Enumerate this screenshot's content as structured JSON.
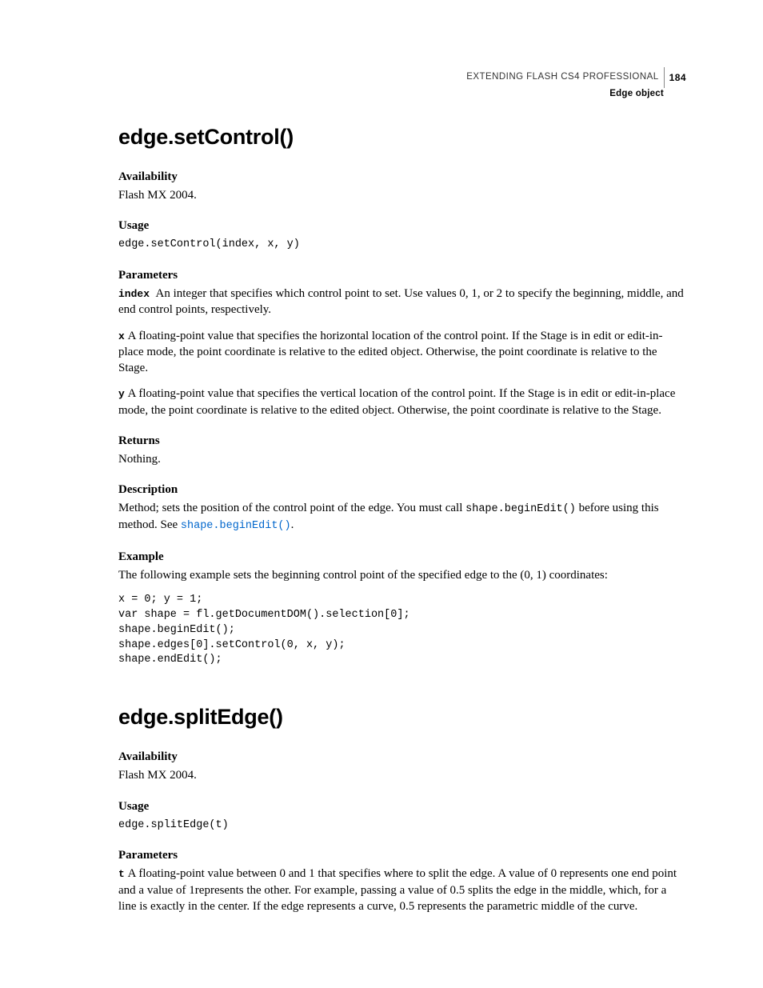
{
  "header": {
    "doc_title": "EXTENDING FLASH CS4 PROFESSIONAL",
    "page_number": "184",
    "section": "Edge object"
  },
  "method1": {
    "title": "edge.setControl()",
    "availability": {
      "label": "Availability",
      "text": "Flash MX 2004."
    },
    "usage": {
      "label": "Usage",
      "code": "edge.setControl(index, x, y)"
    },
    "parameters": {
      "label": "Parameters",
      "index": {
        "name": "index",
        "desc": "An integer that specifies which control point to set. Use values 0, 1, or 2 to specify the beginning, middle, and end control points, respectively."
      },
      "x": {
        "name": "x",
        "desc": "A floating-point value that specifies the horizontal location of the control point. If the Stage is in edit or edit-in-place mode, the point coordinate is relative to the edited object. Otherwise, the point coordinate is relative to the Stage."
      },
      "y": {
        "name": "y",
        "desc": "A floating-point value that specifies the vertical location of the control point. If the Stage is in edit or edit-in-place mode, the point coordinate is relative to the edited object. Otherwise, the point coordinate is relative to the Stage."
      }
    },
    "returns": {
      "label": "Returns",
      "text": "Nothing."
    },
    "description": {
      "label": "Description",
      "pre": "Method; sets the position of the control point of the edge. You must call ",
      "code1": "shape.beginEdit()",
      "mid": " before using this method. See ",
      "link": "shape.beginEdit()",
      "post": "."
    },
    "example": {
      "label": "Example",
      "intro": "The following example sets the beginning control point of the specified edge to the (0, 1) coordinates:",
      "code": "x = 0; y = 1;\nvar shape = fl.getDocumentDOM().selection[0];\nshape.beginEdit();\nshape.edges[0].setControl(0, x, y);\nshape.endEdit();"
    }
  },
  "method2": {
    "title": "edge.splitEdge()",
    "availability": {
      "label": "Availability",
      "text": "Flash MX 2004."
    },
    "usage": {
      "label": "Usage",
      "code": "edge.splitEdge(t)"
    },
    "parameters": {
      "label": "Parameters",
      "t": {
        "name": "t",
        "desc": "A floating-point value between 0 and 1 that specifies where to split the edge. A value of 0 represents one end point and a value of 1represents the other. For example, passing a value of 0.5 splits the edge in the middle, which, for a line is exactly in the center. If the edge represents a curve, 0.5 represents the parametric middle of the curve."
      }
    }
  }
}
